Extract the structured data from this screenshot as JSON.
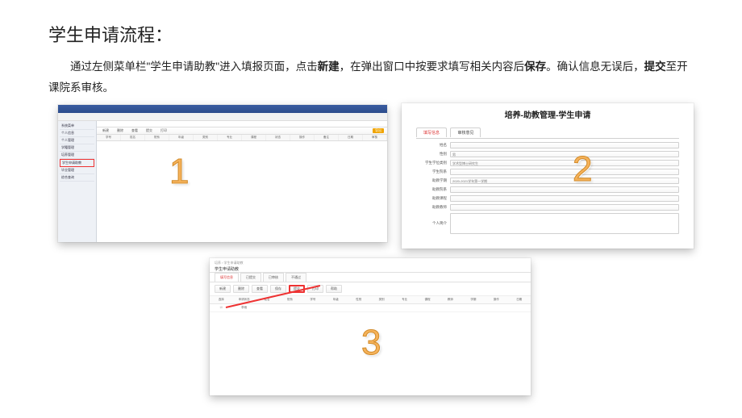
{
  "title": "学生申请流程：",
  "desc": {
    "p1": "通过左侧菜单栏\"学生申请助教\"进入填报页面，点击",
    "b1": "新建",
    "p2": "，在弹出窗口中按要求填写相关内容后",
    "b2": "保存",
    "p3": "。确认信息无误后，",
    "b3": "提交",
    "p4": "至开课院系审核。"
  },
  "steps": {
    "n1": "1",
    "n2": "2",
    "n3": "3"
  },
  "shot1": {
    "sidebar": [
      "系统菜单",
      "个人信息",
      "个人管理",
      "学籍管理",
      "培养管理",
      "学生申请助教",
      "毕业管理",
      "综合查询"
    ],
    "toolbar": [
      "新建",
      "删除",
      "查看",
      "提交",
      "打印",
      "导出"
    ],
    "cols": [
      "学号",
      "姓名",
      "院系",
      "年级",
      "类别",
      "专业",
      "课程",
      "状态",
      "操作",
      "备注",
      "日期",
      "审核"
    ]
  },
  "shot2": {
    "title": "培养-助教管理-学生申请",
    "tabs": [
      "填写信息",
      "审核意见"
    ],
    "labels": [
      "姓名",
      "性别",
      "学生学位类别",
      "学生院系",
      "助教学期",
      "助教院系",
      "助教课程",
      "助教教师",
      "个人简介"
    ],
    "values": [
      "",
      "男",
      "学术型博士研究生",
      "",
      "2020-2021学年第一学期",
      "",
      "",
      "",
      ""
    ]
  },
  "shot3": {
    "breadcrumb": "培养 › 学生申请助教",
    "header": "学生申请助教",
    "tabs": [
      "填写信息",
      "已提交",
      "已审核",
      "不通过"
    ],
    "tools": [
      "新建",
      "删除",
      "查看",
      "保存",
      "提交",
      "打印",
      "帮助"
    ],
    "submit_label": "提交",
    "cols": [
      "选择",
      "申请状态",
      "姓名",
      "院系",
      "学号",
      "年级",
      "性别",
      "类别",
      "专业",
      "课程",
      "教师",
      "学期",
      "操作",
      "日期"
    ],
    "row": [
      "☑",
      "草稿",
      "",
      "",
      "",
      "",
      "",
      "",
      "",
      "",
      "",
      "",
      "",
      ""
    ]
  }
}
